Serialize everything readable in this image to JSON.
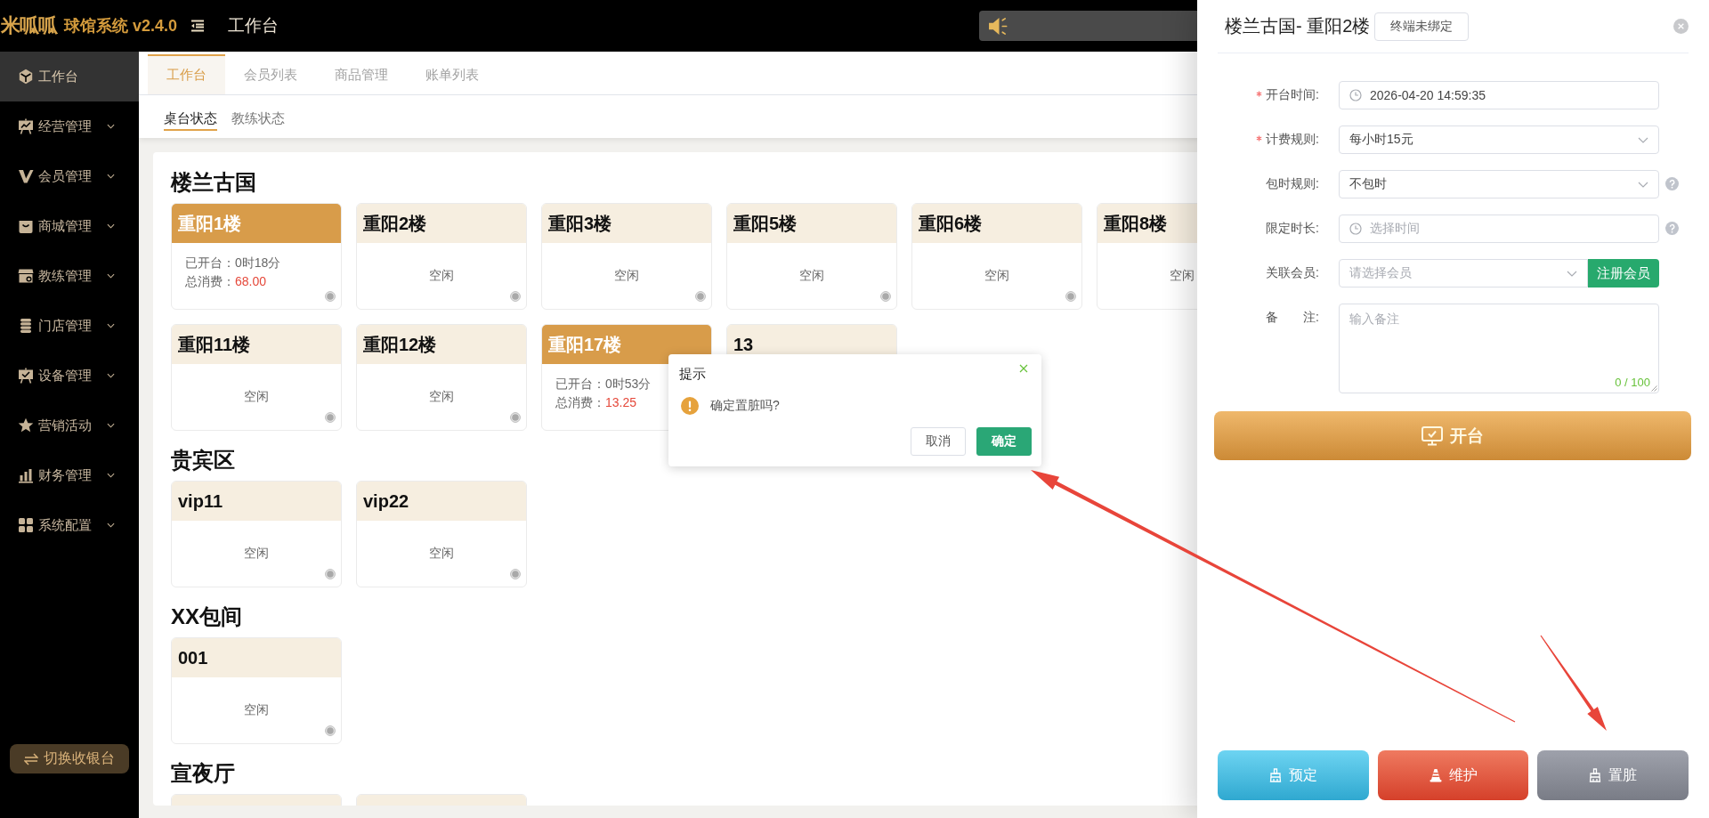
{
  "header": {
    "logo": "米呱呱",
    "title": "球馆系统 v2.4.0",
    "page_title": "工作台"
  },
  "sidebar": {
    "items": [
      {
        "label": "工作台",
        "selected": true
      },
      {
        "label": "经营管理",
        "selected": false,
        "expandable": true
      },
      {
        "label": "会员管理",
        "selected": false,
        "expandable": true
      },
      {
        "label": "商城管理",
        "selected": false,
        "expandable": true
      },
      {
        "label": "教练管理",
        "selected": false,
        "expandable": true
      },
      {
        "label": "门店管理",
        "selected": false,
        "expandable": true
      },
      {
        "label": "设备管理",
        "selected": false,
        "expandable": true
      },
      {
        "label": "营销活动",
        "selected": false,
        "expandable": true
      },
      {
        "label": "财务管理",
        "selected": false,
        "expandable": true
      },
      {
        "label": "系统配置",
        "selected": false,
        "expandable": true
      }
    ],
    "switch_button": "切换收银台"
  },
  "tabs": [
    {
      "label": "工作台",
      "selected": true
    },
    {
      "label": "会员列表",
      "selected": false
    },
    {
      "label": "商品管理",
      "selected": false
    },
    {
      "label": "账单列表",
      "selected": false
    }
  ],
  "subtabs": [
    {
      "label": "桌台状态",
      "selected": true
    },
    {
      "label": "教练状态",
      "selected": false
    }
  ],
  "sections": [
    {
      "title": "楼兰古国",
      "cards": [
        {
          "name": "重阳1楼",
          "occupied": true,
          "indicator_on": false,
          "details": [
            {
              "label": "已开台：",
              "value": "0时18分",
              "kind": "plain"
            },
            {
              "label": "总消费：",
              "value": "68.00",
              "kind": "amount"
            }
          ]
        },
        {
          "name": "重阳2楼",
          "occupied": false,
          "indicator_on": false,
          "status": "空闲"
        },
        {
          "name": "重阳3楼",
          "occupied": false,
          "indicator_on": false,
          "status": "空闲"
        },
        {
          "name": "重阳5楼",
          "occupied": false,
          "indicator_on": false,
          "status": "空闲"
        },
        {
          "name": "重阳6楼",
          "occupied": false,
          "indicator_on": false,
          "status": "空闲"
        },
        {
          "name": "重阳8楼",
          "occupied": false,
          "status": "空闲"
        },
        {
          "name": "重阳11楼",
          "occupied": false,
          "indicator_on": false,
          "status": "空闲"
        },
        {
          "name": "重阳12楼",
          "occupied": false,
          "indicator_on": false,
          "status": "空闲"
        },
        {
          "name": "重阳17楼",
          "occupied": true,
          "details": [
            {
              "label": "已开台：",
              "value": "0时53分",
              "kind": "plain"
            },
            {
              "label": "总消费：",
              "value": "13.25",
              "kind": "amount"
            }
          ]
        },
        {
          "name": "13",
          "occupied": false
        }
      ]
    },
    {
      "title": "贵宾区",
      "cards": [
        {
          "name": "vip11",
          "occupied": false,
          "indicator_on": false,
          "status": "空闲"
        },
        {
          "name": "vip22",
          "occupied": false,
          "indicator_on": false,
          "status": "空闲"
        }
      ]
    },
    {
      "title": "XX包间",
      "cards": [
        {
          "name": "001",
          "occupied": false,
          "indicator_on": false,
          "status": "空闲"
        }
      ]
    },
    {
      "title": "宣夜厅",
      "cards": [
        {
          "occupied": false
        },
        {
          "occupied": false
        }
      ]
    }
  ],
  "popconfirm": {
    "title": "提示",
    "message": "确定置脏吗?",
    "buttons": [
      {
        "label": "取消",
        "kind": "default"
      },
      {
        "label": "确定",
        "kind": "primary"
      }
    ]
  },
  "drawer": {
    "title": "楼兰古国- 重阳2楼",
    "tag": "终端未绑定",
    "fields": [
      {
        "kind": "datetime",
        "label": "开台时间:",
        "required": true,
        "value": "2026-04-20 14:59:35"
      },
      {
        "kind": "select",
        "label": "计费规则:",
        "required": true,
        "value": "每小时15元"
      },
      {
        "kind": "select",
        "label": "包时规则:",
        "help": true,
        "value": "不包时"
      },
      {
        "kind": "datetime",
        "label": "限定时长:",
        "help": true,
        "placeholder": "选择时间"
      },
      {
        "kind": "member",
        "label": "关联会员:",
        "placeholder": "请选择会员",
        "button": "注册会员"
      },
      {
        "kind": "textarea",
        "label": "备　　注:",
        "placeholder": "输入备注",
        "counter": "0 / 100"
      }
    ],
    "open_button": "开台",
    "actions": [
      {
        "label": "预定",
        "kind": "reserve"
      },
      {
        "label": "维护",
        "kind": "maintenance"
      },
      {
        "label": "置脏",
        "kind": "dirty"
      }
    ]
  }
}
